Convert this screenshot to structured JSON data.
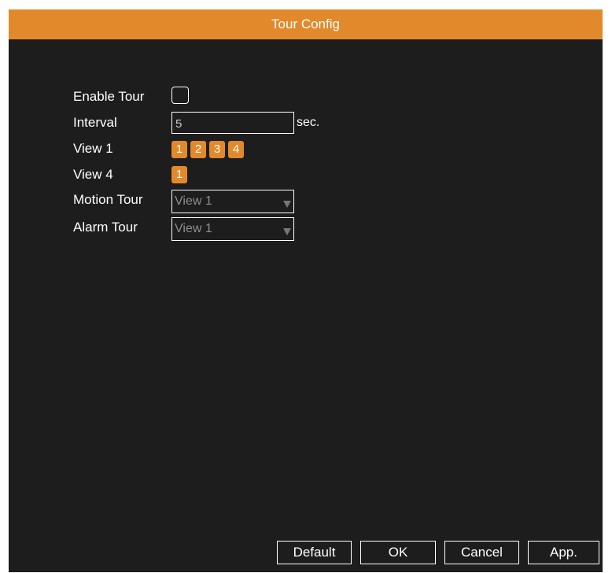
{
  "title": "Tour Config",
  "enable_tour": {
    "label": "Enable Tour",
    "checked": false
  },
  "interval": {
    "label": "Interval",
    "value": "5",
    "unit": "sec."
  },
  "view1": {
    "label": "View 1",
    "chips": [
      "1",
      "2",
      "3",
      "4"
    ]
  },
  "view4": {
    "label": "View 4",
    "chips": [
      "1"
    ]
  },
  "motion_tour": {
    "label": "Motion Tour",
    "selected": "View 1"
  },
  "alarm_tour": {
    "label": "Alarm Tour",
    "selected": "View 1"
  },
  "buttons": {
    "default": "Default",
    "ok": "OK",
    "cancel": "Cancel",
    "apply": "App."
  },
  "colors": {
    "accent": "#e28a2b",
    "background": "#1d1d1d",
    "text": "#ffffff"
  }
}
